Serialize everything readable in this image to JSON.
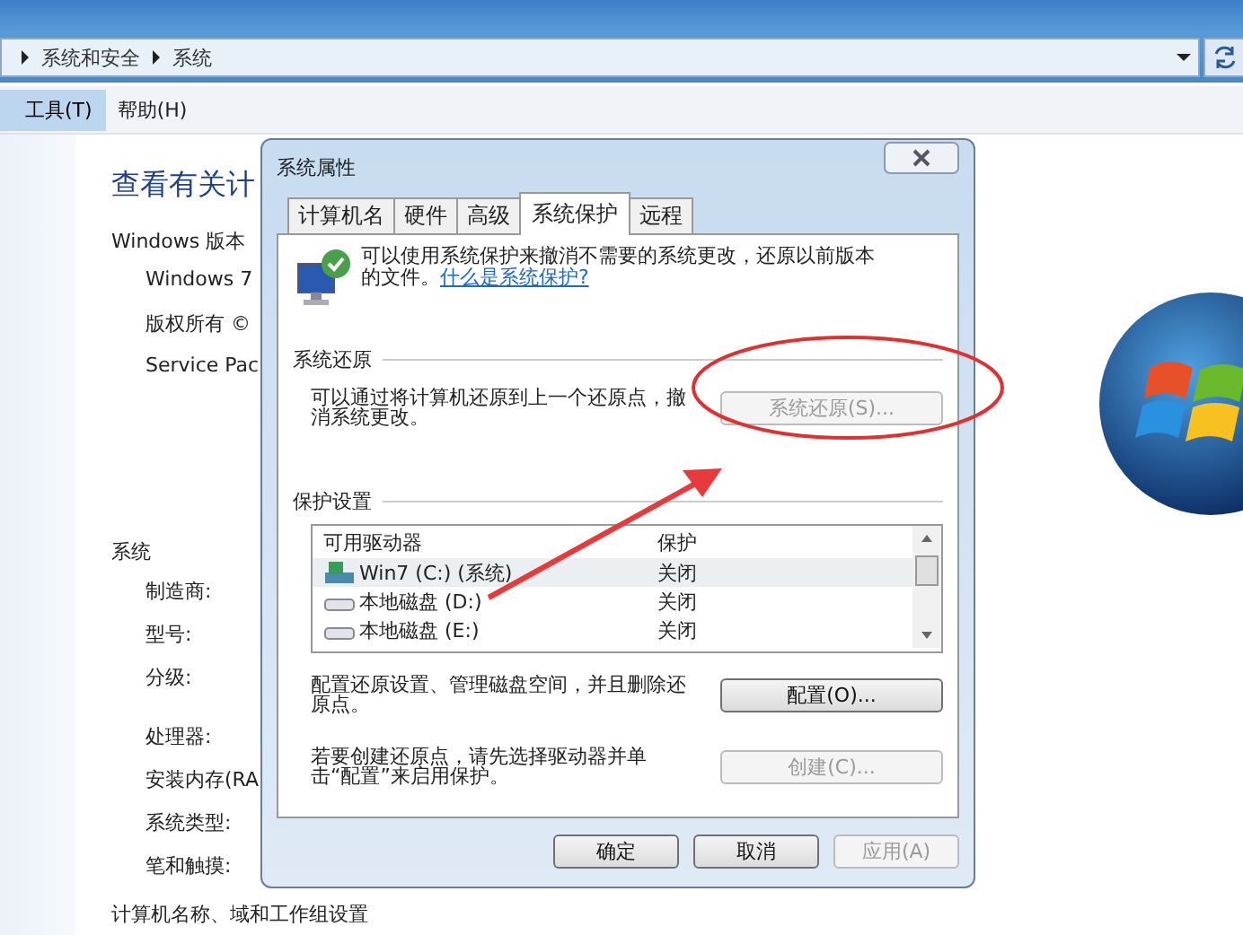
{
  "breadcrumb": [
    "系统和安全",
    "系统"
  ],
  "menu": [
    {
      "label": "工具(T)",
      "selected": true
    },
    {
      "label": "帮助(H)",
      "selected": false
    }
  ],
  "page": {
    "title": "查看有关计",
    "edition_heading": "Windows 版本",
    "edition_items": [
      "Windows 7",
      "版权所有 ©",
      "Service Pac"
    ],
    "system_heading": "系统",
    "system_items_a": [
      "制造商:",
      "型号:",
      "分级:"
    ],
    "system_items_b": [
      "处理器:",
      "安装内存(RA",
      "系统类型:",
      "笔和触摸:"
    ],
    "footer_heading": "计算机名称、域和工作组设置"
  },
  "dialog": {
    "title": "系统属性",
    "tabs": [
      {
        "label": "计算机名",
        "selected": false
      },
      {
        "label": "硬件",
        "selected": false
      },
      {
        "label": "高级",
        "selected": false
      },
      {
        "label": "系统保护",
        "selected": true
      },
      {
        "label": "远程",
        "selected": false
      }
    ],
    "intro": "可以使用系统保护来撤消不需要的系统更改，还原以前版本的文件。",
    "intro_link": "什么是系统保护?",
    "restore_group": "系统还原",
    "restore_text": "可以通过将计算机还原到上一个还原点，撤消系统更改。",
    "restore_button": {
      "label": "系统还原(S)...",
      "disabled": true
    },
    "protection_group": "保护设置",
    "columns": [
      "可用驱动器",
      "保护"
    ],
    "drives": [
      {
        "kind": "system",
        "name": "Win7 (C:) (系统)",
        "protection": "关闭",
        "selected": true
      },
      {
        "kind": "disk",
        "name": "本地磁盘 (D:)",
        "protection": "关闭",
        "selected": false
      },
      {
        "kind": "disk",
        "name": "本地磁盘 (E:)",
        "protection": "关闭",
        "selected": false
      }
    ],
    "configure_text": "配置还原设置、管理磁盘空间，并且删除还原点。",
    "configure_button": {
      "label": "配置(O)...",
      "disabled": false
    },
    "create_text": "若要创建还原点，请先选择驱动器并单击“配置”来启用保护。",
    "create_button": {
      "label": "创建(C)...",
      "disabled": true
    },
    "buttons": [
      {
        "label": "确定",
        "disabled": false
      },
      {
        "label": "取消",
        "disabled": false
      },
      {
        "label": "应用(A)",
        "disabled": true
      }
    ]
  }
}
